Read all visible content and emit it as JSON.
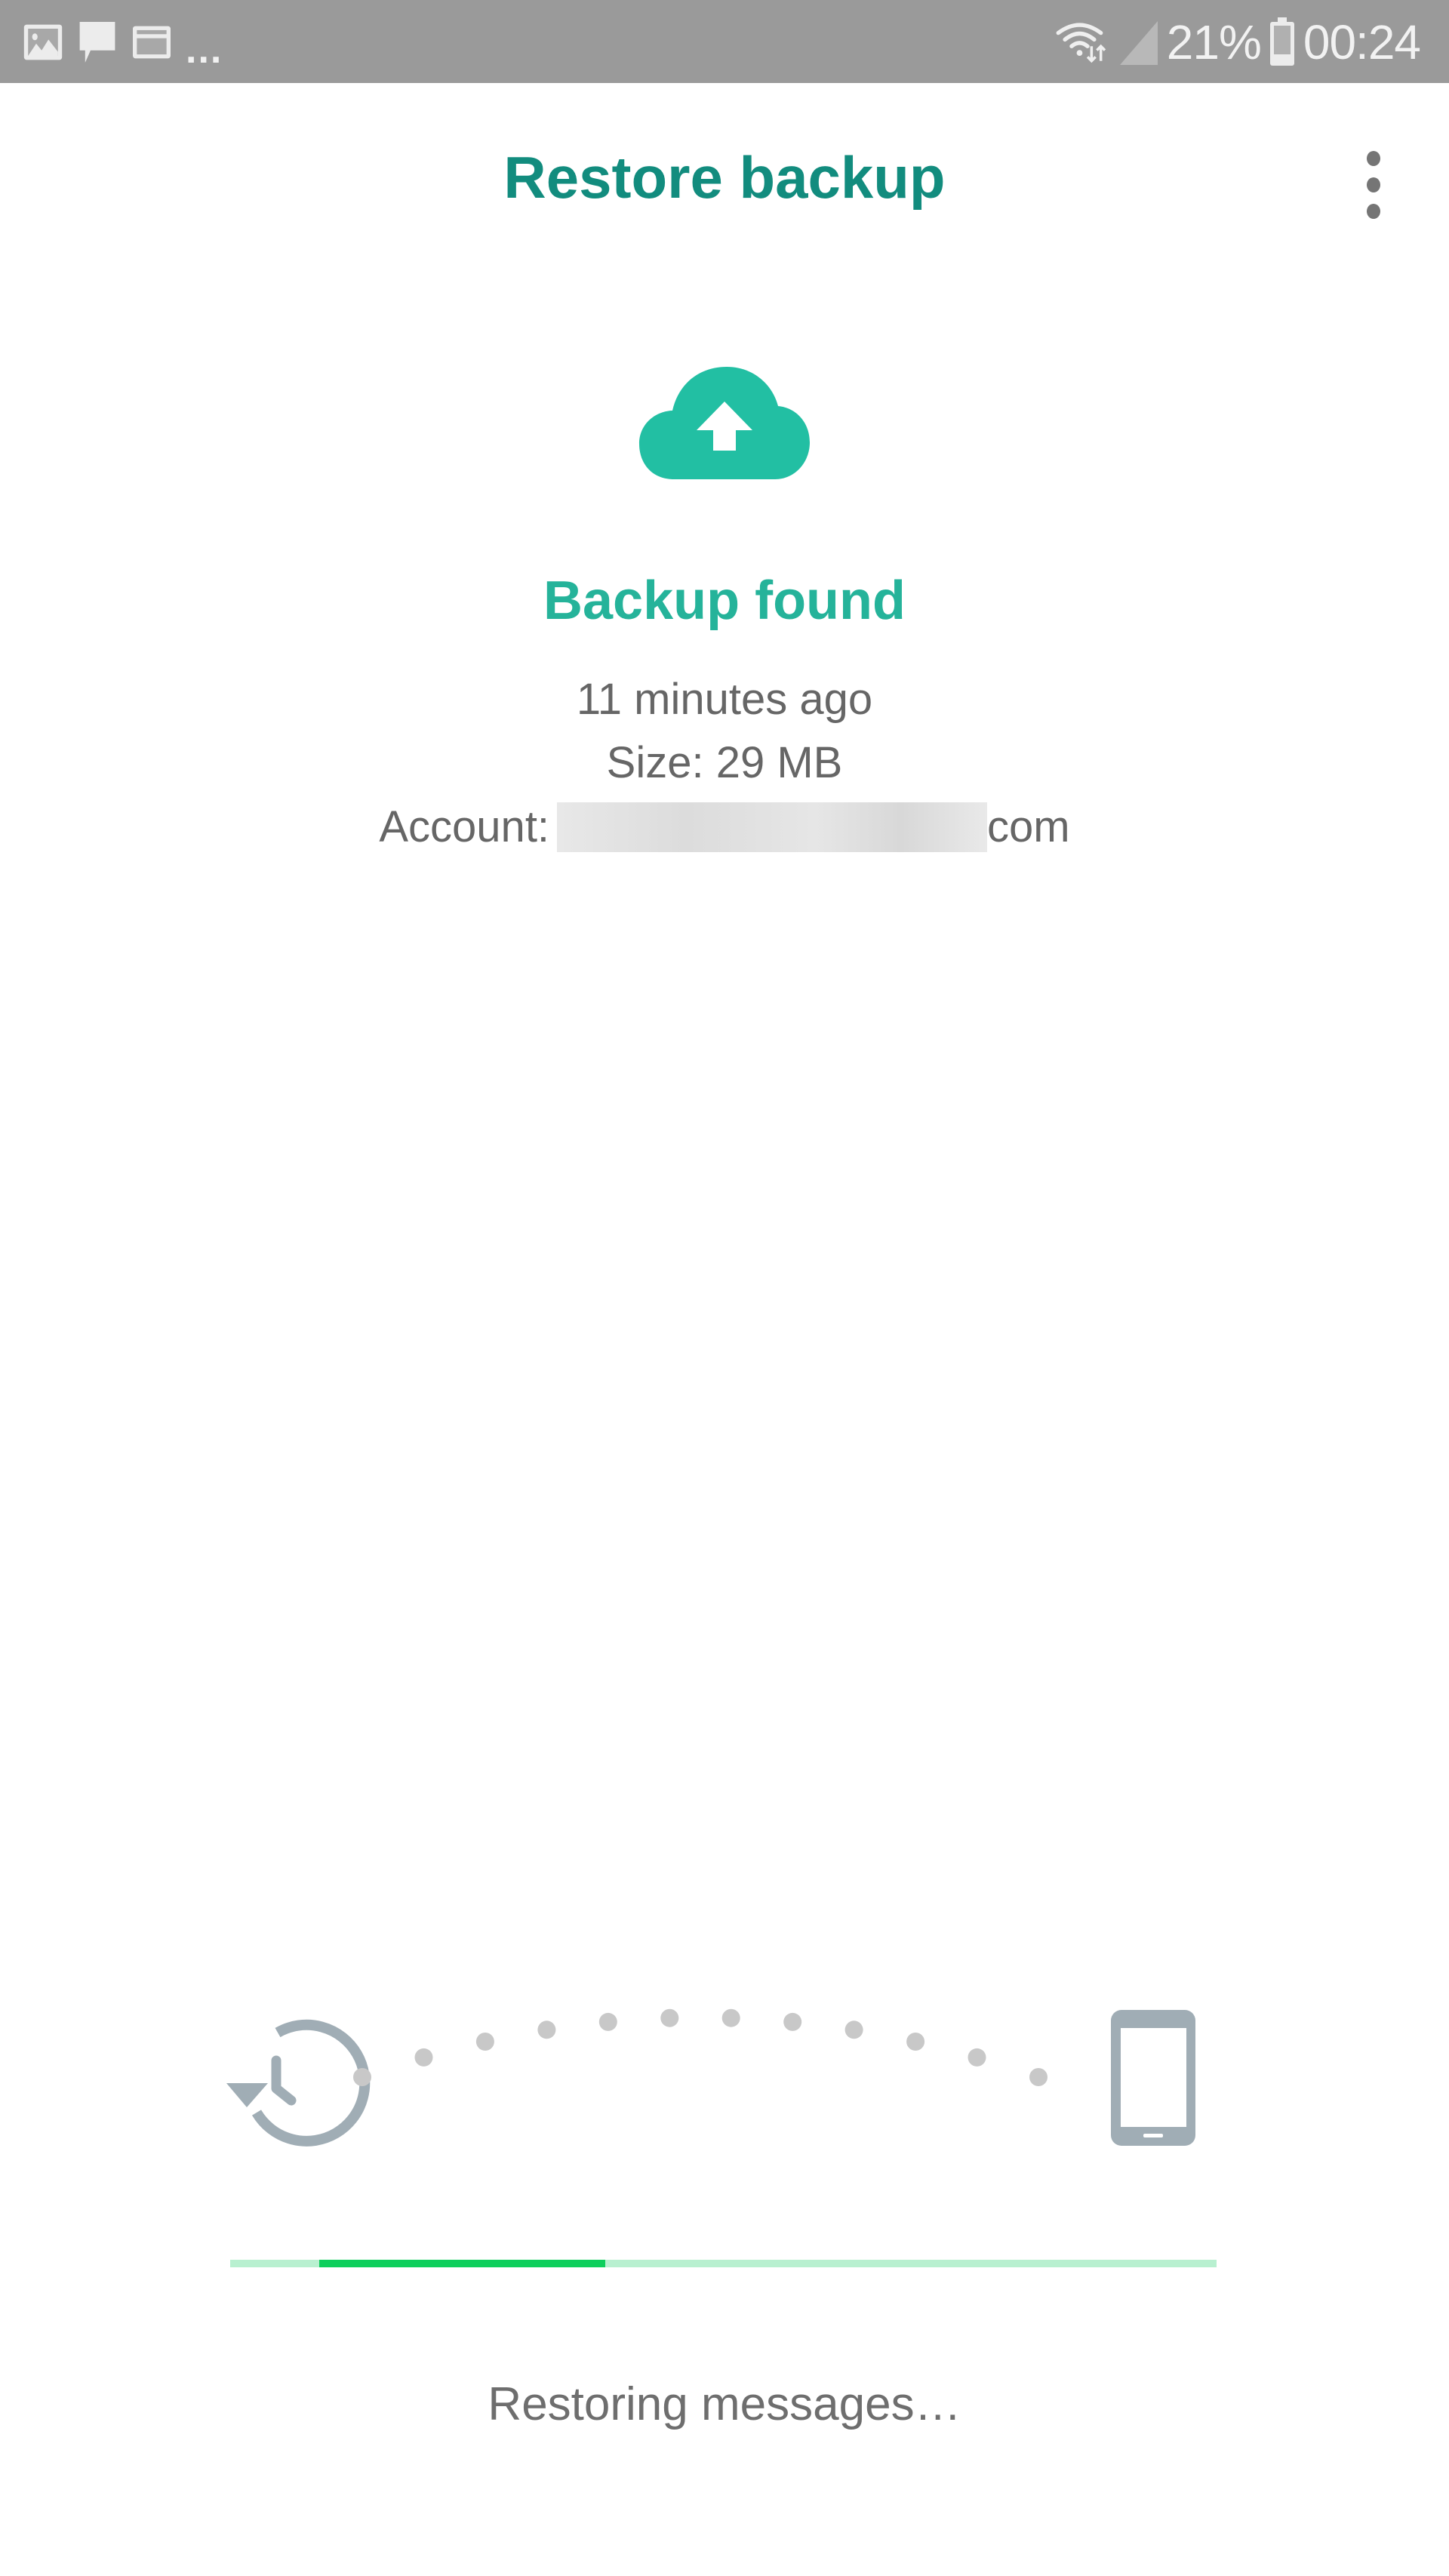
{
  "status_bar": {
    "notification_icons": [
      "image-icon",
      "message-icon",
      "card-icon"
    ],
    "more_indicator": "...",
    "battery_percent": "21%",
    "time": "00:24",
    "icons": [
      "wifi-data-icon",
      "cell-signal-icon",
      "battery-icon"
    ]
  },
  "app_bar": {
    "title": "Restore backup",
    "overflow_menu_icon": "more-vert-icon"
  },
  "backup": {
    "icon": "cloud-upload-icon",
    "title": "Backup found",
    "age": "11 minutes ago",
    "size": "Size: 29 MB",
    "account_label": "Account:",
    "account_value_redacted": true,
    "account_suffix": "com"
  },
  "restore_animation": {
    "source_icon": "restore-history-icon",
    "target_icon": "smartphone-icon",
    "dot_count": 12
  },
  "progress": {
    "indeterminate": true,
    "fill_start_fraction": 0.09,
    "fill_end_fraction": 0.38
  },
  "status_text": "Restoring messages…",
  "colors": {
    "accent_dark": "#128c7e",
    "accent": "#25b39a",
    "progress_fill": "#0dcf5c",
    "progress_track": "#b8f0d0",
    "icon_gray": "#a0adb5",
    "dot_gray": "#c8c8c8",
    "status_bar": "#9a9a9a"
  }
}
